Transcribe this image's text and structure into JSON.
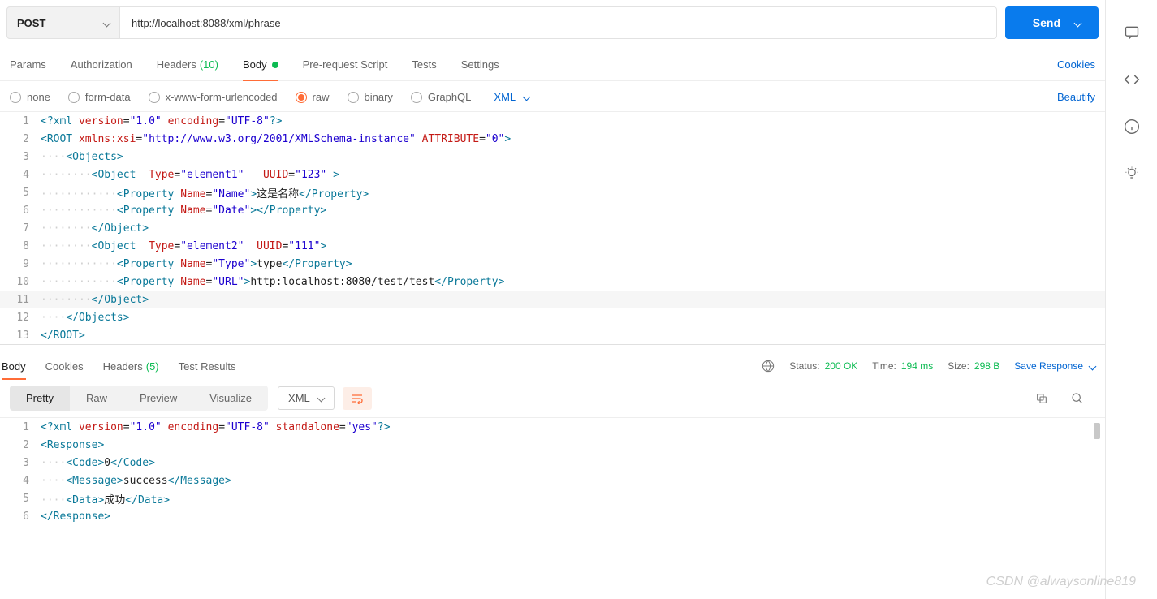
{
  "request": {
    "method": "POST",
    "url": "http://localhost:8088/xml/phrase",
    "send_label": "Send"
  },
  "tabs": {
    "params": "Params",
    "authorization": "Authorization",
    "headers": "Headers",
    "headers_count": "(10)",
    "body": "Body",
    "prereq": "Pre-request Script",
    "tests": "Tests",
    "settings": "Settings",
    "cookies": "Cookies"
  },
  "body_types": {
    "none": "none",
    "formdata": "form-data",
    "xwww": "x-www-form-urlencoded",
    "raw": "raw",
    "binary": "binary",
    "graphql": "GraphQL",
    "lang": "XML",
    "beautify": "Beautify"
  },
  "request_body_lines": [
    {
      "n": 1,
      "html": "<span class='pi'>&lt;?xml</span> <span class='attr'>version</span>=<span class='val'>\"1.0\"</span> <span class='attr'>encoding</span>=<span class='val'>\"UTF-8\"</span><span class='pi'>?&gt;</span>"
    },
    {
      "n": 2,
      "html": "<span class='tag'>&lt;ROOT</span> <span class='attr'>xmlns:xsi</span>=<span class='val'>\"http://www.w3.org/2001/XMLSchema-instance\"</span> <span class='attr'>ATTRIBUTE</span>=<span class='val'>\"0\"</span><span class='tag'>&gt;</span>"
    },
    {
      "n": 3,
      "html": "<span class='guide'>····</span><span class='tag'>&lt;Objects&gt;</span>"
    },
    {
      "n": 4,
      "html": "<span class='guide'>········</span><span class='tag'>&lt;Object</span>  <span class='attr'>Type</span>=<span class='val'>\"element1\"</span>   <span class='attr'>UUID</span>=<span class='val'>\"123\"</span> <span class='tag'>&gt;</span>"
    },
    {
      "n": 5,
      "html": "<span class='guide'>············</span><span class='tag'>&lt;Property</span> <span class='attr'>Name</span>=<span class='val'>\"Name\"</span><span class='tag'>&gt;</span><span class='txt'>这是名称</span><span class='tag'>&lt;/Property&gt;</span>"
    },
    {
      "n": 6,
      "html": "<span class='guide'>············</span><span class='tag'>&lt;Property</span> <span class='attr'>Name</span>=<span class='val'>\"Date\"</span><span class='tag'>&gt;&lt;/Property&gt;</span>"
    },
    {
      "n": 7,
      "html": "<span class='guide'>········</span><span class='tag'>&lt;/Object&gt;</span>"
    },
    {
      "n": 8,
      "html": "<span class='guide'>········</span><span class='tag'>&lt;Object</span>  <span class='attr'>Type</span>=<span class='val'>\"element2\"</span>  <span class='attr'>UUID</span>=<span class='val'>\"111\"</span><span class='tag'>&gt;</span>"
    },
    {
      "n": 9,
      "html": "<span class='guide'>············</span><span class='tag'>&lt;Property</span> <span class='attr'>Name</span>=<span class='val'>\"Type\"</span><span class='tag'>&gt;</span><span class='txt'>type</span><span class='tag'>&lt;/Property&gt;</span>"
    },
    {
      "n": 10,
      "html": "<span class='guide'>············</span><span class='tag'>&lt;Property</span> <span class='attr'>Name</span>=<span class='val'>\"URL\"</span><span class='tag'>&gt;</span><span class='txt'>http:localhost:8080/test/test</span><span class='tag'>&lt;/Property&gt;</span>"
    },
    {
      "n": 11,
      "caret": true,
      "html": "<span class='guide'>········</span><span class='tag'>&lt;/Object&gt;</span>"
    },
    {
      "n": 12,
      "html": "<span class='guide'>····</span><span class='tag'>&lt;/Objects&gt;</span>"
    },
    {
      "n": 13,
      "html": "<span class='tag'>&lt;/ROOT&gt;</span>"
    }
  ],
  "response_tabs": {
    "body": "Body",
    "cookies": "Cookies",
    "headers": "Headers",
    "headers_count": "(5)",
    "test_results": "Test Results"
  },
  "response_meta": {
    "status_label": "Status:",
    "status_value": "200 OK",
    "time_label": "Time:",
    "time_value": "194 ms",
    "size_label": "Size:",
    "size_value": "298 B",
    "save_label": "Save Response"
  },
  "response_views": {
    "pretty": "Pretty",
    "raw": "Raw",
    "preview": "Preview",
    "visualize": "Visualize",
    "format": "XML"
  },
  "response_body_lines": [
    {
      "n": 1,
      "html": "<span class='pi'>&lt;?xml</span> <span class='attr'>version</span>=<span class='val'>\"1.0\"</span> <span class='attr'>encoding</span>=<span class='val'>\"UTF-8\"</span> <span class='attr'>standalone</span>=<span class='val'>\"yes\"</span><span class='pi'>?&gt;</span>"
    },
    {
      "n": 2,
      "html": "<span class='tag'>&lt;Response&gt;</span>"
    },
    {
      "n": 3,
      "html": "<span class='guide'>····</span><span class='tag'>&lt;Code&gt;</span><span class='txt'>0</span><span class='tag'>&lt;/Code&gt;</span>"
    },
    {
      "n": 4,
      "html": "<span class='guide'>····</span><span class='tag'>&lt;Message&gt;</span><span class='txt'>success</span><span class='tag'>&lt;/Message&gt;</span>"
    },
    {
      "n": 5,
      "html": "<span class='guide'>····</span><span class='tag'>&lt;Data&gt;</span><span class='txt'>成功</span><span class='tag'>&lt;/Data&gt;</span>"
    },
    {
      "n": 6,
      "html": "<span class='tag'>&lt;/Response&gt;</span>"
    }
  ],
  "watermark": "CSDN @alwaysonline819"
}
